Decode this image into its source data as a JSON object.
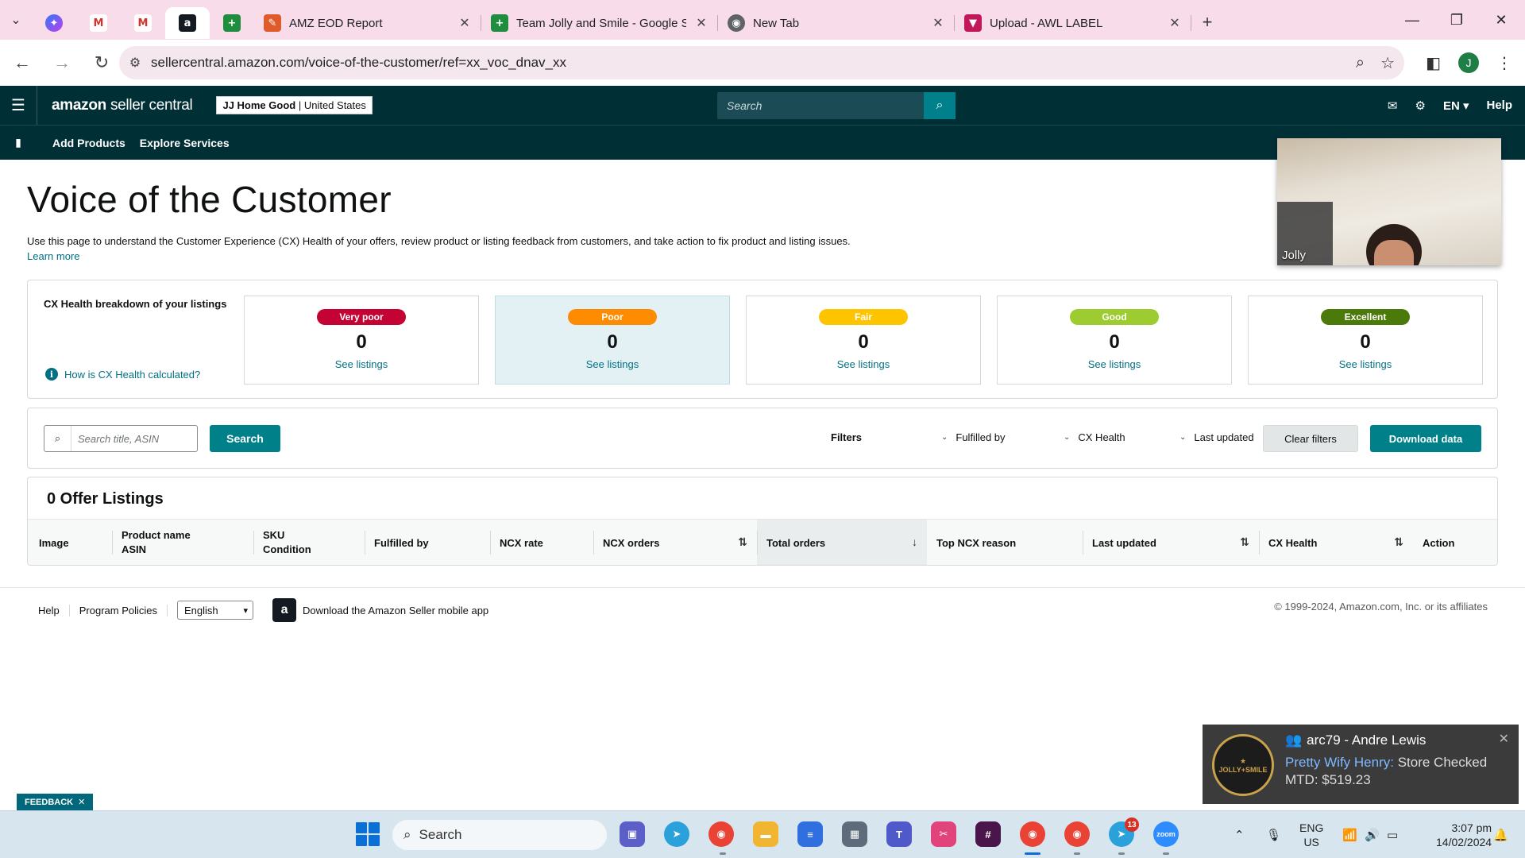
{
  "browser": {
    "tabs": [
      {
        "title": "AMZ EOD Report",
        "favicon_color": "#e05b2b"
      },
      {
        "title": "Team Jolly and Smile - Google S",
        "favicon_color": "#1e8e3e"
      },
      {
        "title": "New Tab",
        "favicon_color": "#5f6368"
      },
      {
        "title": "Upload - AWL LABEL",
        "favicon_color": "#c2185b"
      }
    ],
    "url": "sellercentral.amazon.com/voice-of-the-customer/ref=xx_voc_dnav_xx",
    "profile_initial": "J"
  },
  "header": {
    "logo_bold": "amazon",
    "logo_light": "seller central",
    "store_name": "JJ Home Good",
    "store_region": "United States",
    "search_placeholder": "Search",
    "language": "EN",
    "help": "Help"
  },
  "subnav": {
    "items": [
      "Add Products",
      "Explore Services"
    ]
  },
  "page": {
    "title": "Voice of the Customer",
    "description": "Use this page to understand the Customer Experience (CX) Health of your offers, review product or listing feedback from customers, and take action to fix product and listing issues.",
    "learn_more": "Learn more"
  },
  "cx_health": {
    "title": "CX Health breakdown of your listings",
    "help_link": "How is CX Health calculated?",
    "cards": [
      {
        "label": "Very poor",
        "count": "0",
        "link": "See listings",
        "color": "#c40233",
        "text_color": "#ffffff"
      },
      {
        "label": "Poor",
        "count": "0",
        "link": "See listings",
        "color": "#ff8c00",
        "text_color": "#ffffff"
      },
      {
        "label": "Fair",
        "count": "0",
        "link": "See listings",
        "color": "#ffc400",
        "text_color": "#ffffff"
      },
      {
        "label": "Good",
        "count": "0",
        "link": "See listings",
        "color": "#9ccc2f",
        "text_color": "#ffffff"
      },
      {
        "label": "Excellent",
        "count": "0",
        "link": "See listings",
        "color": "#4c7a0a",
        "text_color": "#ffffff"
      }
    ]
  },
  "filters": {
    "search_placeholder": "Search title, ASIN",
    "search_button": "Search",
    "filters_label": "Filters",
    "dropdowns": [
      "Fulfilled by",
      "CX Health",
      "Last updated"
    ],
    "clear_button": "Clear filters",
    "download_button": "Download data"
  },
  "listings": {
    "title": "0 Offer Listings",
    "columns": {
      "image": "Image",
      "product_name": "Product name",
      "asin": "ASIN",
      "sku": "SKU",
      "condition": "Condition",
      "fulfilled_by": "Fulfilled by",
      "ncx_rate": "NCX rate",
      "ncx_orders": "NCX orders",
      "total_orders": "Total orders",
      "top_ncx_reason": "Top NCX reason",
      "last_updated": "Last updated",
      "cx_health": "CX Health",
      "action": "Action"
    }
  },
  "footer": {
    "help": "Help",
    "program_policies": "Program Policies",
    "language": "English",
    "app_link": "Download the Amazon Seller mobile app",
    "copyright": "© 1999-2024, Amazon.com, Inc. or its affiliates"
  },
  "video": {
    "participant_name": "Jolly"
  },
  "notification": {
    "title": "arc79 - Andre Lewis",
    "sender": "Pretty Wify Henry:",
    "message": "Store Checked MTD: $519.23"
  },
  "feedback": {
    "label": "FEEDBACK"
  },
  "taskbar": {
    "search_label": "Search",
    "telegram_badge": "13",
    "input_lang": "ENG",
    "input_region": "US",
    "time": "3:07 pm",
    "date": "14/02/2024"
  }
}
